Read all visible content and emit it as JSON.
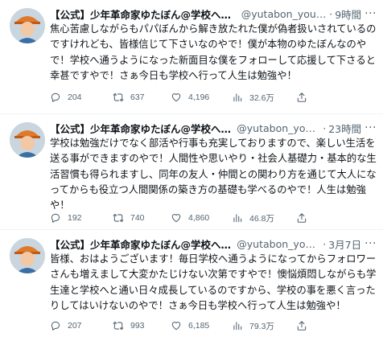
{
  "tweets": [
    {
      "name": "【公式】少年革命家ゆたぼん@学校へ行...",
      "handle": "@yutabon_yout...",
      "separator": "·",
      "time": "9時間",
      "text": "焦心苦慮しながらもパパぼんから解き放たれた僕が偽者扱いされているのですけれども、皆様信じて下さいなのやで！僕が本物のゆたぼんなのやで！学校へ通うようになった新面目な僕をフォローして応援して下さると幸甚ですやで！さぁ今日も学校へ行って人生は勉強や！",
      "replies": "204",
      "retweets": "637",
      "likes": "4,196",
      "views": "32.6万"
    },
    {
      "name": "【公式】少年革命家ゆたぼん@学校へ行...",
      "handle": "@yutabon_yout...",
      "separator": "·",
      "time": "23時間",
      "text": "学校は勉強だけでなく部活や行事も充実しておりますので、楽しい生活を送る事ができますのやで！人間性や思いやり・社会人基礎力・基本的な生活習慣も得られますし、同年の友人・仲間との関わり方を通じて大人になってからも役立つ人間関係の築き方の基礎も学べるのやで！人生は勉強や！",
      "replies": "192",
      "retweets": "740",
      "likes": "4,860",
      "views": "46.8万"
    },
    {
      "name": "【公式】少年革命家ゆたぼん@学校へ行...",
      "handle": "@yutabon_yout...",
      "separator": "·",
      "time": "3月7日",
      "text": "皆様、おはようございます！毎日学校へ通うようになってからフォロワーさんも増えまして大変かたじけない次第ですやで！懊悩煩悶しながらも学生達と学校へと通い日々成長しているのですから、学校の事を悪く言ったりしてはいけないのやで！さぁ今日も学校へ行って人生は勉強や！",
      "replies": "207",
      "retweets": "993",
      "likes": "6,185",
      "views": "79.3万"
    }
  ],
  "icons": {
    "reply": "reply-icon",
    "retweet": "retweet-icon",
    "like": "heart-icon",
    "views": "analytics-icon",
    "share": "share-icon",
    "more": "more-icon"
  },
  "more_glyph": "···",
  "colors": {
    "text": "#0f1419",
    "secondary": "#536471",
    "divider": "#eff3f4",
    "background": "#ffffff"
  }
}
